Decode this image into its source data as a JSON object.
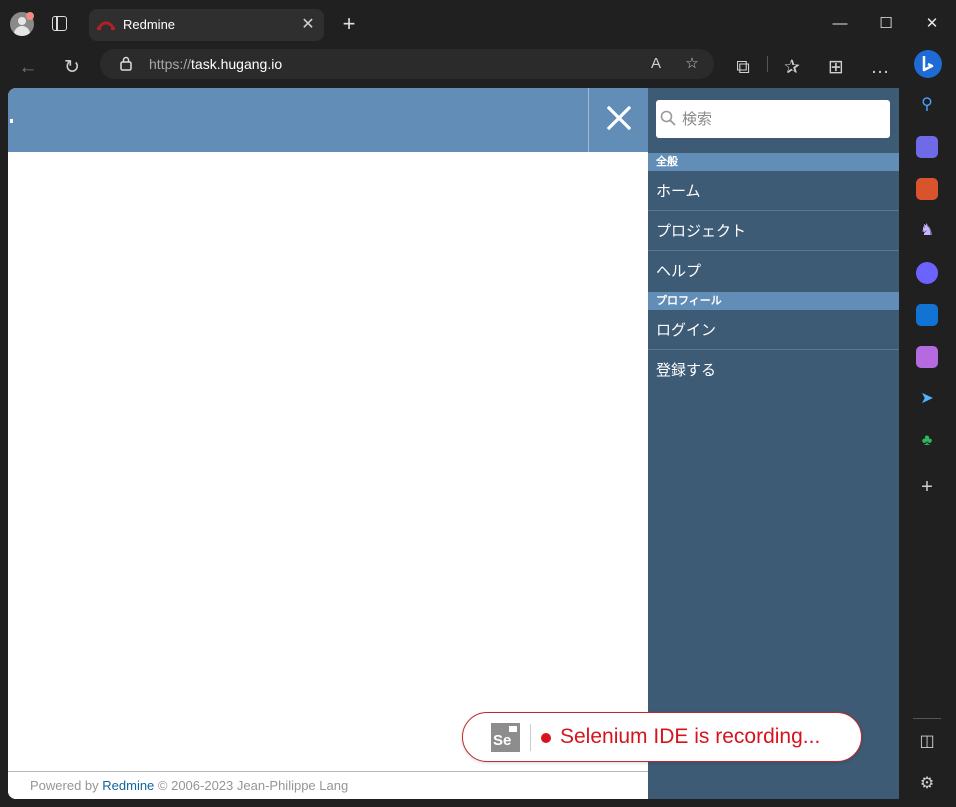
{
  "browser": {
    "tab_title": "Redmine",
    "url_prefix": "https://",
    "url_host": "task.hugang.io",
    "icons": {
      "profile": "profile-avatar-icon",
      "tab_actions": "tab-actions-icon",
      "close_tab": "close-icon",
      "new_tab": "plus-icon",
      "back": "back-arrow-icon",
      "refresh": "refresh-icon",
      "lock": "lock-icon",
      "read_aloud": "read-aloud-icon",
      "add_favorite": "add-favorite-icon",
      "extensions": "puzzle-icon",
      "favorites": "favorites-icon",
      "collections": "collections-icon",
      "more": "ellipsis-icon",
      "copilot": "copilot-icon",
      "minimize": "minimize-icon",
      "maximize": "maximize-icon",
      "close_window": "close-icon"
    },
    "sidebar_icons": [
      "search-icon",
      "shopping-tag-icon",
      "tools-icon",
      "games-icon",
      "copilot-icon",
      "outlook-icon",
      "designer-icon",
      "send-icon",
      "tree-icon",
      "plus-icon",
      "sidebar-toggle-icon",
      "gear-icon"
    ]
  },
  "page": {
    "menu": {
      "search_placeholder": "検索",
      "section_general": "全般",
      "home": "ホーム",
      "projects": "プロジェクト",
      "help": "ヘルプ",
      "section_profile": "プロフィール",
      "login": "ログイン",
      "register": "登録する"
    },
    "footer": {
      "powered_by": "Powered by ",
      "link": "Redmine",
      "copyright": " © 2006-2023 Jean-Philippe Lang"
    }
  },
  "selenium": {
    "logo_text": "Se",
    "message": "Selenium IDE is recording..."
  },
  "colors": {
    "header": "#628db6",
    "flyout": "#3e5b76",
    "recording": "#d5151d"
  }
}
